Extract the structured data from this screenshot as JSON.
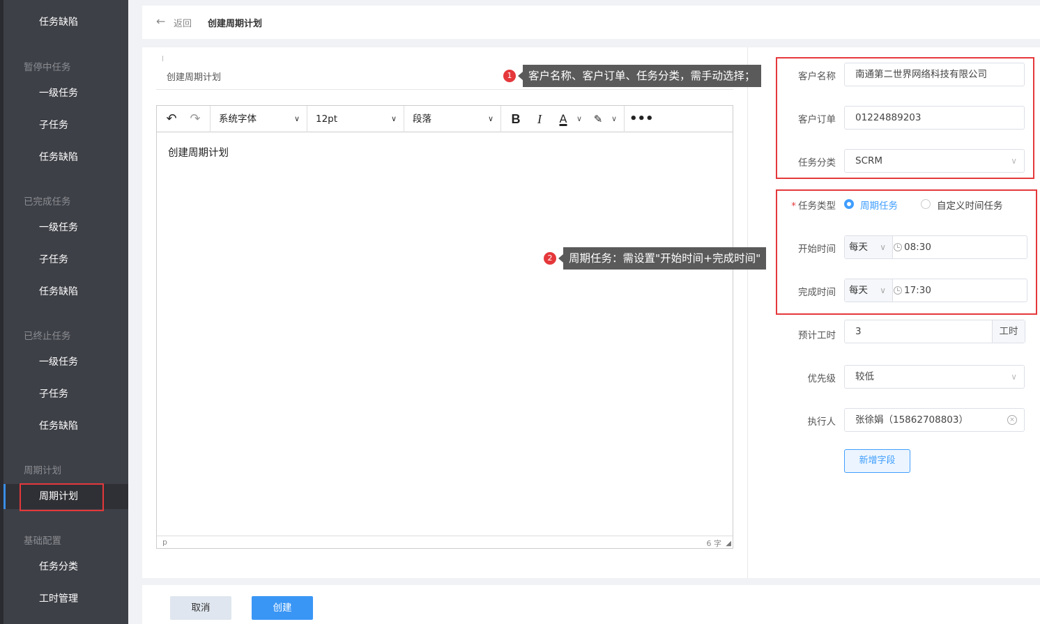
{
  "sidebar": {
    "items": [
      {
        "label": "任务缺陷",
        "type": "item"
      },
      {
        "label": "暂停中任务",
        "type": "group"
      },
      {
        "label": "一级任务",
        "type": "item"
      },
      {
        "label": "子任务",
        "type": "item"
      },
      {
        "label": "任务缺陷",
        "type": "item"
      },
      {
        "label": "已完成任务",
        "type": "group"
      },
      {
        "label": "一级任务",
        "type": "item"
      },
      {
        "label": "子任务",
        "type": "item"
      },
      {
        "label": "任务缺陷",
        "type": "item"
      },
      {
        "label": "已终止任务",
        "type": "group"
      },
      {
        "label": "一级任务",
        "type": "item"
      },
      {
        "label": "子任务",
        "type": "item"
      },
      {
        "label": "任务缺陷",
        "type": "item"
      },
      {
        "label": "周期计划",
        "type": "group"
      },
      {
        "label": "周期计划",
        "type": "item",
        "active": true
      },
      {
        "label": "基础配置",
        "type": "group"
      },
      {
        "label": "任务分类",
        "type": "item"
      },
      {
        "label": "工时管理",
        "type": "item"
      }
    ]
  },
  "header": {
    "back_label": "返回",
    "title": "创建周期计划"
  },
  "editor": {
    "title_value": "创建周期计划",
    "font_family": "系统字体",
    "font_size": "12pt",
    "block_format": "段落",
    "body_text": "创建周期计划",
    "status_path": "p",
    "word_count": "6 字"
  },
  "annotations": {
    "tip1_num": "1",
    "tip1_text": "客户名称、客户订单、任务分类，需手动选择；",
    "tip2_num": "2",
    "tip2_text": "周期任务：需设置\"开始时间+完成时间\""
  },
  "form": {
    "customer_name_label": "客户名称",
    "customer_name_value": "南通第二世界网络科技有限公司",
    "customer_order_label": "客户订单",
    "customer_order_value": "01224889203",
    "task_category_label": "任务分类",
    "task_category_value": "SCRM",
    "task_type_required": "*",
    "task_type_label": "任务类型",
    "task_type_option1": "周期任务",
    "task_type_option2": "自定义时间任务",
    "start_time_label": "开始时间",
    "start_freq": "每天",
    "start_time": "08:30",
    "end_time_label": "完成时间",
    "end_freq": "每天",
    "end_time": "17:30",
    "est_hours_label": "预计工时",
    "est_hours_value": "3",
    "est_hours_unit": "工时",
    "priority_label": "优先级",
    "priority_value": "较低",
    "assignee_label": "执行人",
    "assignee_value": "张徐娟（15862708803）",
    "add_field_label": "新增字段"
  },
  "footer": {
    "cancel_label": "取消",
    "create_label": "创建"
  },
  "colors": {
    "sidebar_bg": "#3e4047",
    "primary": "#409eff",
    "highlight_red": "#e5383b",
    "tooltip_bg": "#5a5a5a"
  }
}
